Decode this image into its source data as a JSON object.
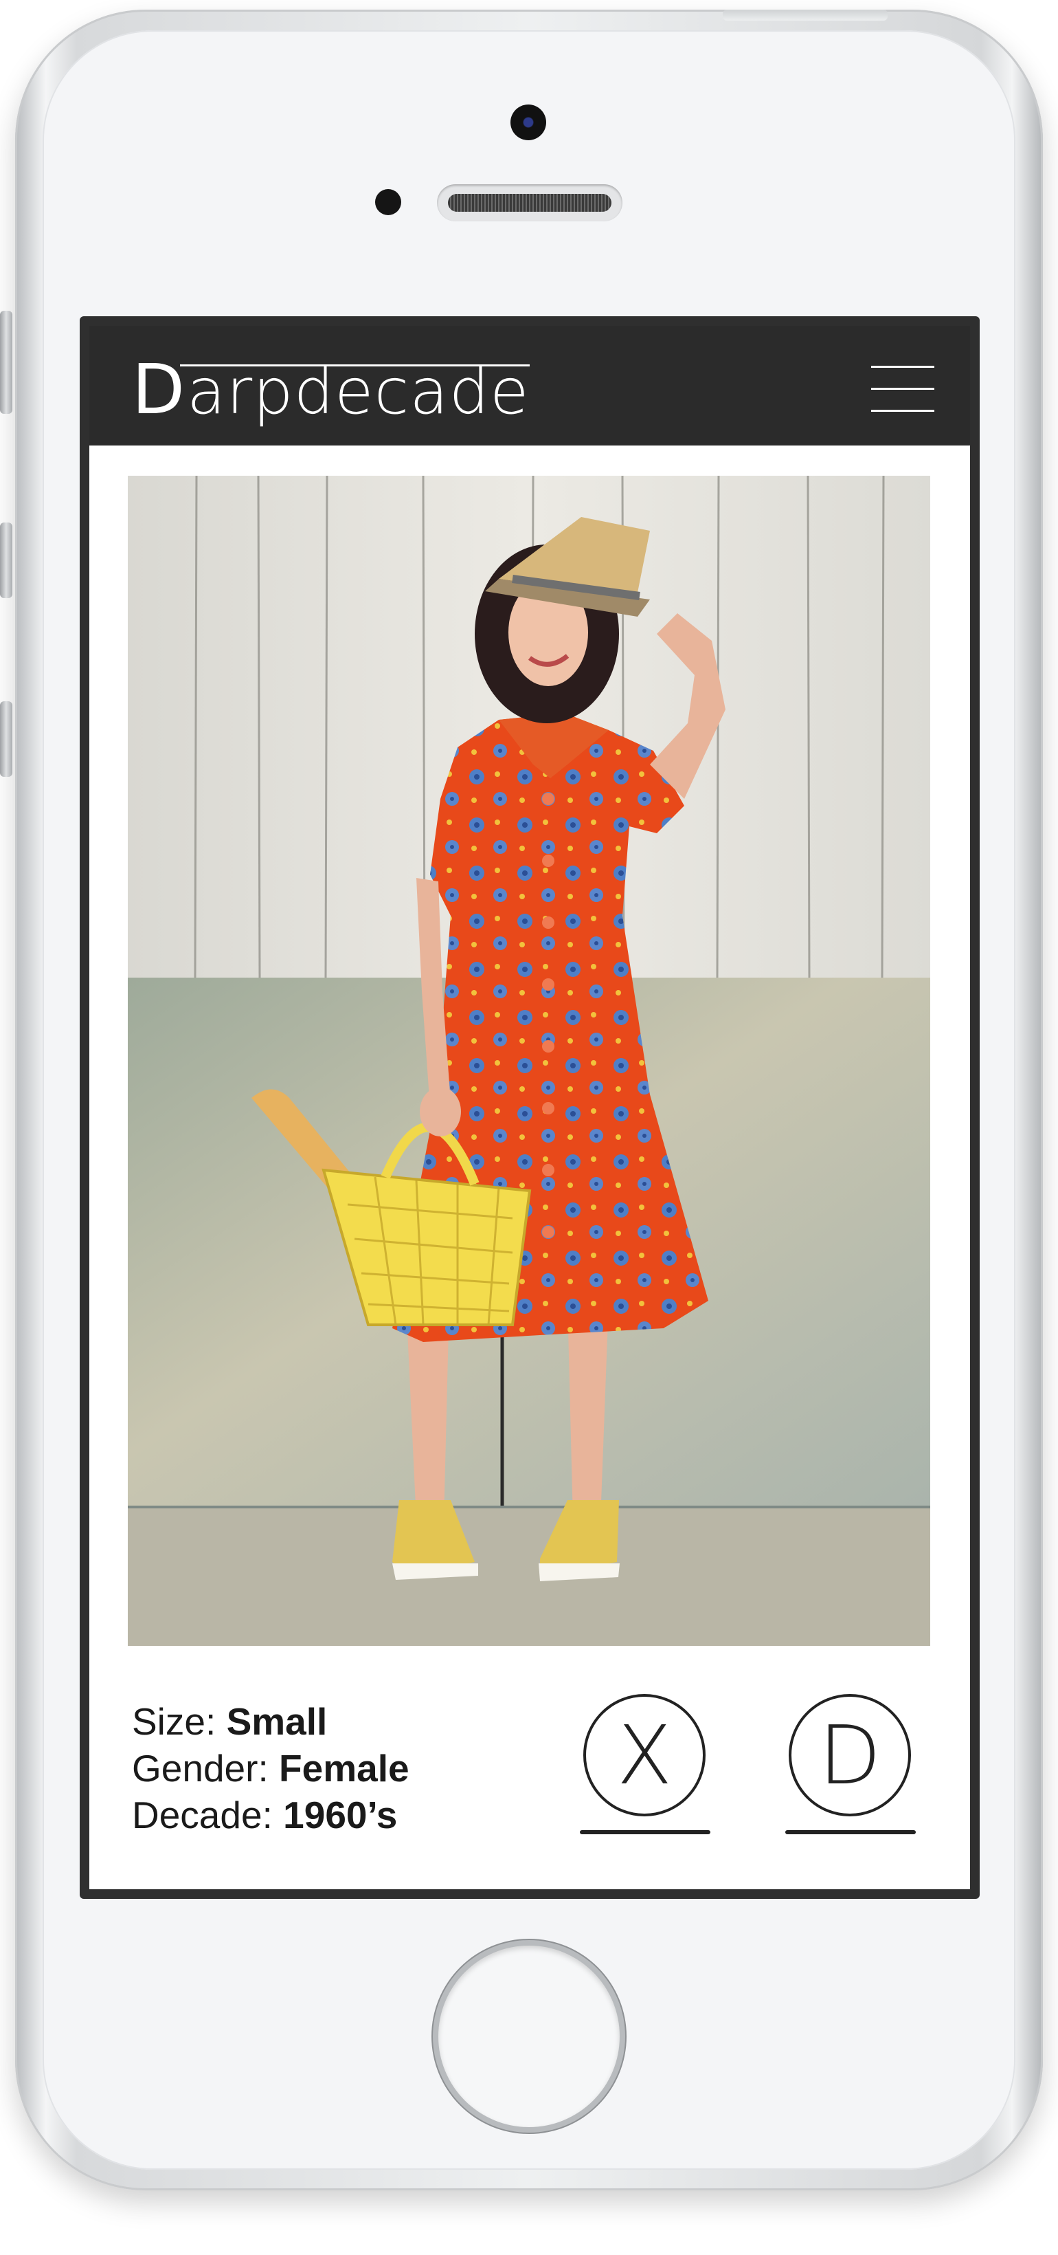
{
  "app": {
    "logo_letter": "D",
    "logo_rest": "arpdecade"
  },
  "header": {
    "menu_icon": "hamburger-menu-icon"
  },
  "product": {
    "size_label": "Size: ",
    "size_value": "Small",
    "gender_label": "Gender: ",
    "gender_value": "Female",
    "decade_label": "Decade: ",
    "decade_value": "1960’s"
  },
  "actions": {
    "dismiss_symbol": "X",
    "darp_symbol": "D"
  },
  "colors": {
    "header_bg": "#2b2b2b",
    "dress": "#ea4a14",
    "basket": "#f1d84a",
    "shoes": "#e8c951"
  }
}
